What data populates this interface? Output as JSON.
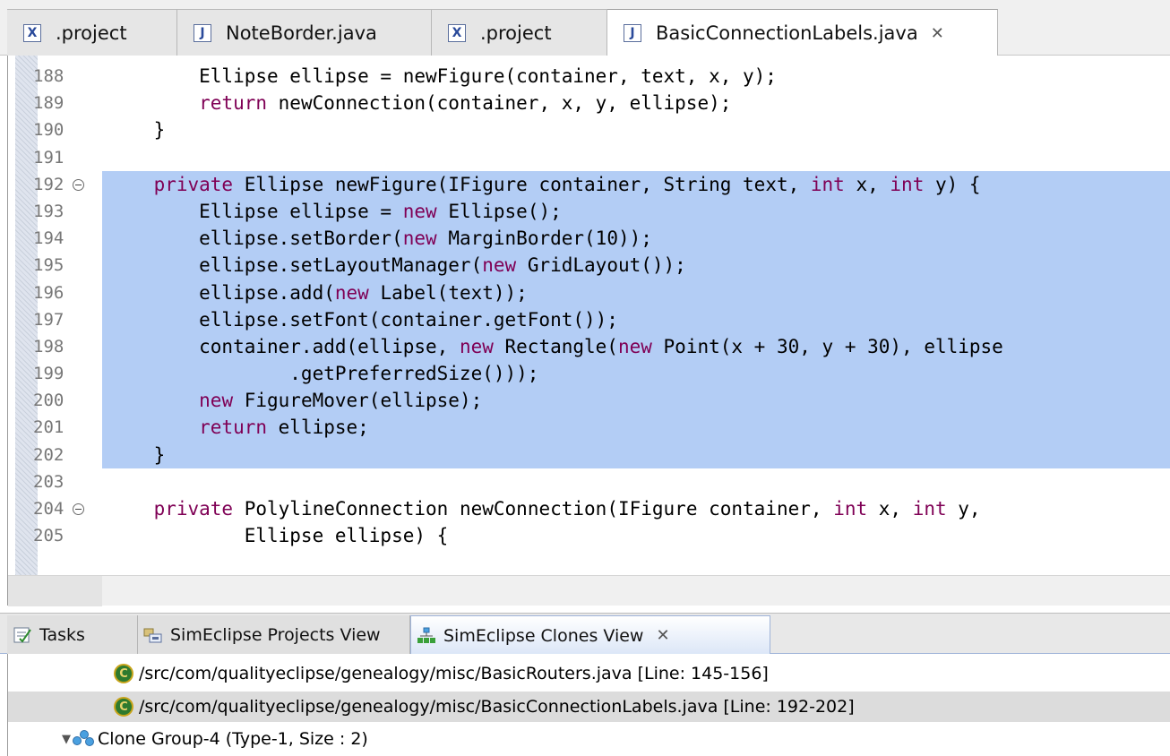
{
  "editor_tabs": [
    {
      "label": ".project",
      "icon": "xml-file-icon",
      "icon_glyph": "X"
    },
    {
      "label": "NoteBorder.java",
      "icon": "java-file-icon",
      "icon_glyph": "J"
    },
    {
      "label": ".project",
      "icon": "xml-file-icon",
      "icon_glyph": "X"
    },
    {
      "label": "BasicConnectionLabels.java",
      "icon": "java-file-icon",
      "icon_glyph": "J",
      "active": true,
      "close_glyph": "✕"
    }
  ],
  "editor": {
    "lines": [
      {
        "no": "188",
        "parts": [
          [
            "",
            "        Ellipse ellipse = newFigure(container, text, x, y);"
          ]
        ]
      },
      {
        "no": "189",
        "parts": [
          [
            "",
            "        "
          ],
          [
            "kw",
            "return"
          ],
          [
            "",
            " newConnection(container, x, y, ellipse);"
          ]
        ]
      },
      {
        "no": "190",
        "parts": [
          [
            "",
            "    }"
          ]
        ]
      },
      {
        "no": "191",
        "parts": [
          [
            "",
            ""
          ]
        ]
      },
      {
        "no": "192",
        "fold": true,
        "selected": true,
        "parts": [
          [
            "",
            "    "
          ],
          [
            "kw",
            "private"
          ],
          [
            "",
            " Ellipse newFigure(IFigure container, String text, "
          ],
          [
            "kw",
            "int"
          ],
          [
            "",
            " x, "
          ],
          [
            "kw",
            "int"
          ],
          [
            "",
            " y) {"
          ]
        ]
      },
      {
        "no": "193",
        "selected": true,
        "parts": [
          [
            "",
            "        Ellipse ellipse = "
          ],
          [
            "kw",
            "new"
          ],
          [
            "",
            " Ellipse();"
          ]
        ]
      },
      {
        "no": "194",
        "selected": true,
        "parts": [
          [
            "",
            "        ellipse.setBorder("
          ],
          [
            "kw",
            "new"
          ],
          [
            "",
            " MarginBorder(10));"
          ]
        ]
      },
      {
        "no": "195",
        "selected": true,
        "parts": [
          [
            "",
            "        ellipse.setLayoutManager("
          ],
          [
            "kw",
            "new"
          ],
          [
            "",
            " GridLayout());"
          ]
        ]
      },
      {
        "no": "196",
        "selected": true,
        "parts": [
          [
            "",
            "        ellipse.add("
          ],
          [
            "kw",
            "new"
          ],
          [
            "",
            " Label(text));"
          ]
        ]
      },
      {
        "no": "197",
        "selected": true,
        "parts": [
          [
            "",
            "        ellipse.setFont(container.getFont());"
          ]
        ]
      },
      {
        "no": "198",
        "selected": true,
        "parts": [
          [
            "",
            "        container.add(ellipse, "
          ],
          [
            "kw",
            "new"
          ],
          [
            "",
            " Rectangle("
          ],
          [
            "kw",
            "new"
          ],
          [
            "",
            " Point(x + 30, y + 30), ellipse"
          ]
        ]
      },
      {
        "no": "199",
        "selected": true,
        "parts": [
          [
            "",
            "                .getPreferredSize()));"
          ]
        ]
      },
      {
        "no": "200",
        "selected": true,
        "parts": [
          [
            "",
            "        "
          ],
          [
            "kw",
            "new"
          ],
          [
            "",
            " FigureMover(ellipse);"
          ]
        ]
      },
      {
        "no": "201",
        "selected": true,
        "parts": [
          [
            "",
            "        "
          ],
          [
            "kw",
            "return"
          ],
          [
            "",
            " ellipse;"
          ]
        ]
      },
      {
        "no": "202",
        "selected": true,
        "parts": [
          [
            "",
            "    }"
          ]
        ]
      },
      {
        "no": "203",
        "parts": [
          [
            "",
            ""
          ]
        ]
      },
      {
        "no": "204",
        "fold": true,
        "parts": [
          [
            "",
            "    "
          ],
          [
            "kw",
            "private"
          ],
          [
            "",
            " PolylineConnection newConnection(IFigure container, "
          ],
          [
            "kw",
            "int"
          ],
          [
            "",
            " x, "
          ],
          [
            "kw",
            "int"
          ],
          [
            "",
            " y,"
          ]
        ]
      },
      {
        "no": "205",
        "parts": [
          [
            "",
            "            Ellipse ellipse) {"
          ]
        ]
      }
    ]
  },
  "view_tabs": [
    {
      "label": "Tasks",
      "icon": "tasks-icon"
    },
    {
      "label": "SimEclipse Projects View",
      "icon": "projects-view-icon"
    },
    {
      "label": "SimEclipse Clones View",
      "icon": "clones-view-icon",
      "active": true,
      "close_glyph": "✕"
    }
  ],
  "clones_tree": [
    {
      "kind": "clone",
      "text": "/src/com/qualityeclipse/genealogy/misc/BasicRouters.java [Line: 145-156]",
      "icon_glyph": "C",
      "selected": false
    },
    {
      "kind": "clone",
      "text": "/src/com/qualityeclipse/genealogy/misc/BasicConnectionLabels.java [Line: 192-202]",
      "icon_glyph": "C",
      "selected": true
    },
    {
      "kind": "group",
      "text": "Clone Group-4 (Type-1, Size : 2)",
      "twisty": "▼",
      "icon": "clone-group-icon"
    }
  ],
  "colors": {
    "keyword": "#7f0055",
    "selection": "#b3cdf5",
    "line_number": "#787878"
  }
}
